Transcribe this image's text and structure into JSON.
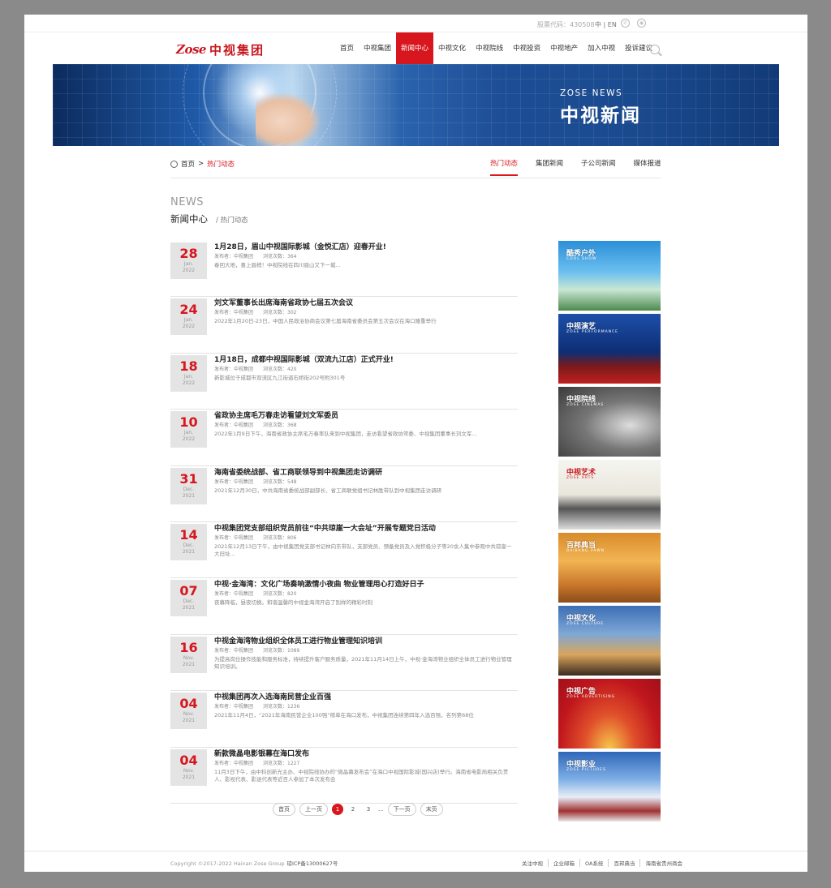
{
  "topbar": {
    "stock": "股票代码：430508",
    "lang": "中 | EN",
    "icons": [
      "wechat-icon",
      "weibo-icon"
    ]
  },
  "logo": {
    "en": "Zose",
    "cn": "中视集团"
  },
  "nav": [
    "首页",
    "中视集团",
    "新闻中心",
    "中视文化",
    "中视院线",
    "中视投资",
    "中视地产",
    "加入中视",
    "投诉建议"
  ],
  "nav_active": "新闻中心",
  "banner": {
    "en": "ZOSE NEWS",
    "cn": "中视新闻"
  },
  "breadcrumb": {
    "home": "首页",
    "sep": ">",
    "current": "热门动态"
  },
  "subtabs": [
    "热门动态",
    "集团新闻",
    "子公司新闻",
    "媒体报道"
  ],
  "section": {
    "en": "NEWS",
    "cn": "新闻中心",
    "sub": "/ 热门动态"
  },
  "news": [
    {
      "day": "28",
      "mon": "Jan.",
      "yr": "2022",
      "title": "1月28日，眉山中视国际影城（金悦汇店）迎春开业!",
      "publisher": "发布者：中视集团",
      "views": "浏览次数：364",
      "summary": "春回大地，喜上眉梢！中视院线在四川眉山又下一城..."
    },
    {
      "day": "24",
      "mon": "Jan.",
      "yr": "2022",
      "title": "刘文军董事长出席海南省政协七届五次会议",
      "publisher": "发布者：中视集团",
      "views": "浏览次数：302",
      "summary": "2022年1月20日-23日，中国人民政治协商会议第七届海南省委员会第五次会议在海口隆重举行"
    },
    {
      "day": "18",
      "mon": "Jan.",
      "yr": "2022",
      "title": "1月18日，成都中视国际影城（双流九江店）正式开业!",
      "publisher": "发布者：中视集团",
      "views": "浏览次数：420",
      "summary": "新影城位于成都市双流区九江街道石桥街202号附301号"
    },
    {
      "day": "10",
      "mon": "Jan.",
      "yr": "2022",
      "title": "省政协主席毛万春走访看望刘文军委员",
      "publisher": "发布者：中视集团",
      "views": "浏览次数：368",
      "summary": "2022年1月9日下午，海南省政协主席毛万春率队来到中视集团，走访看望省政协常委、中视集团董事长刘文军..."
    },
    {
      "day": "31",
      "mon": "Dec.",
      "yr": "2021",
      "title": "海南省委统战部、省工商联领导到中视集团走访调研",
      "publisher": "发布者：中视集团",
      "views": "浏览次数：548",
      "summary": "2021年12月30日，中共海南省委统战部副部长、省工商联党组书记林胜带队到中视集团走访调研"
    },
    {
      "day": "14",
      "mon": "Dec.",
      "yr": "2021",
      "title": "中视集团党支部组织党员前往“中共琼崖一大会址”开展专题党日活动",
      "publisher": "发布者：中视集团",
      "views": "浏览次数：806",
      "summary": "2021年12月13日下午，由中视集团党支部书记林向东带队，支部党员、预备党员及入党积极分子等20余人集中参观中共琼崖一大旧址..."
    },
    {
      "day": "07",
      "mon": "Dec.",
      "yr": "2021",
      "title": "中视·金海湾：文化广场奏响激情小夜曲 物业管理用心打造好日子",
      "publisher": "发布者：中视集团",
      "views": "浏览次数：820",
      "summary": "夜幕降临，昼夜切换。和谐温馨的中视金海湾开启了别样的精彩时刻"
    },
    {
      "day": "16",
      "mon": "Nov.",
      "yr": "2021",
      "title": "中视金海湾物业组织全体员工进行物业管理知识培训",
      "publisher": "发布者：中视集团",
      "views": "浏览次数：1089",
      "summary": "为提高岗位操作技能和服务标准，持续提升客户服务质量，2021年11月14日上午，中视·金海湾物业组织全体员工进行物业管理知识培训。"
    },
    {
      "day": "04",
      "mon": "Nov.",
      "yr": "2021",
      "title": "中视集团再次入选海南民营企业百强",
      "publisher": "发布者：中视集团",
      "views": "浏览次数：1236",
      "summary": "2021年11月4日，“2021年海南民营企业100强”榜单在海口发布，中视集团连续第四年入选百强，名列第68位"
    },
    {
      "day": "04",
      "mon": "Nov.",
      "yr": "2021",
      "title": "新款微晶电影银幕在海口发布",
      "publisher": "发布者：中视集团",
      "views": "浏览次数：1227",
      "summary": "11月3日下午，由中科创新光主办、中视院线协办的“微晶幕发布会”在海口中视国际影城(国兴店)举行。海南省电影局相关负责人、影视代表、影迷代表等近百人参加了本次发布会"
    }
  ],
  "side_cards": [
    {
      "cn": "酷秀户外",
      "en": "COOL SHOW"
    },
    {
      "cn": "中视演艺",
      "en": "ZOSE PERFORMANCE"
    },
    {
      "cn": "中视院线",
      "en": "ZOSE CINEMAS"
    },
    {
      "cn": "中视艺术",
      "en": "ZOSE ARTS"
    },
    {
      "cn": "百邦典当",
      "en": "BAIBANG PAWN"
    },
    {
      "cn": "中视文化",
      "en": "ZOSE CULTURE"
    },
    {
      "cn": "中视广告",
      "en": "ZOSE ADVERTISING"
    },
    {
      "cn": "中视影业",
      "en": "ZOSE PICTURES"
    }
  ],
  "pager": {
    "first": "首页",
    "prev": "上一页",
    "pages": [
      "1",
      "2",
      "3"
    ],
    "dots": "...",
    "next": "下一页",
    "last": "末页"
  },
  "footer": {
    "copyright": "Copyright ©2017-2022 Hainan Zose Group",
    "icp": "琼ICP备13000627号",
    "links": [
      "关注中视",
      "企业邮箱",
      "OA系统",
      "百邦典当",
      "海南省贵州商会"
    ]
  }
}
